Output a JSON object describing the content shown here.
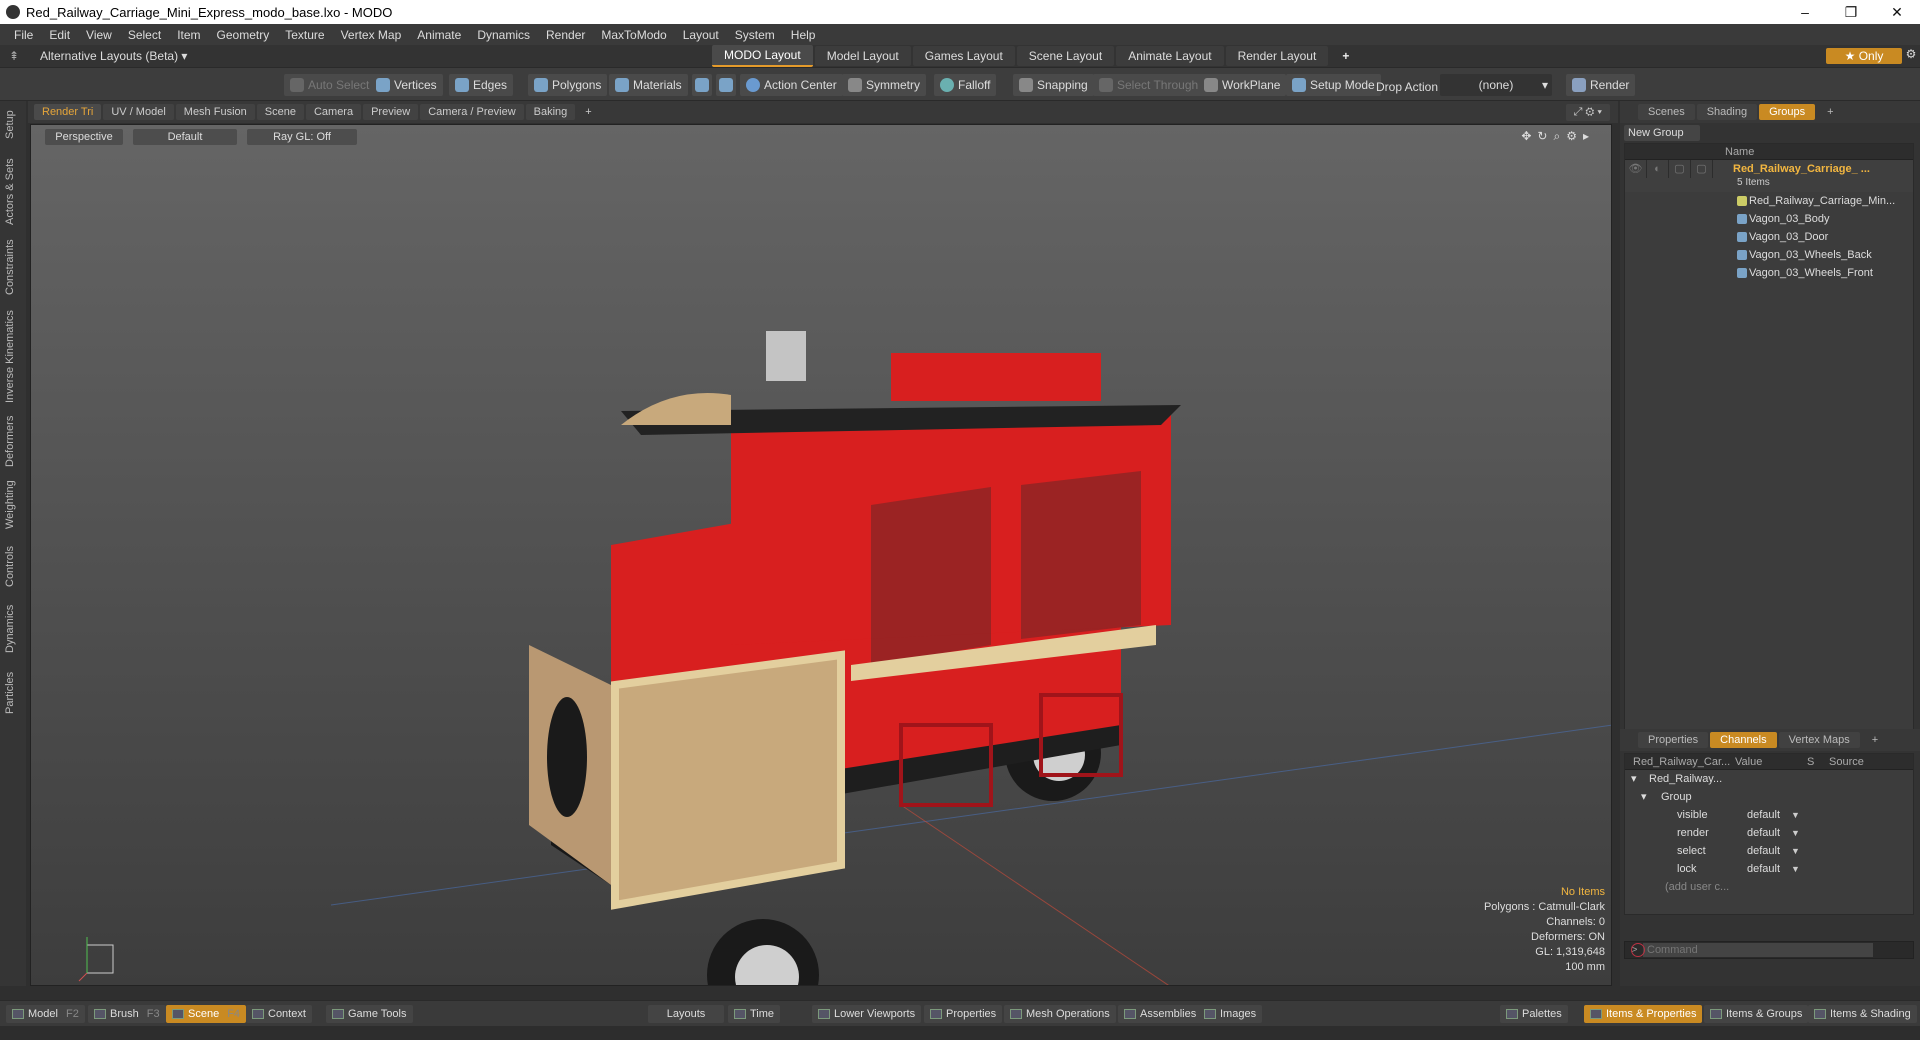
{
  "window": {
    "title": "Red_Railway_Carriage_Mini_Express_modo_base.lxo - MODO",
    "min": "–",
    "max": "❐",
    "close": "✕"
  },
  "menu": [
    "File",
    "Edit",
    "View",
    "Select",
    "Item",
    "Geometry",
    "Texture",
    "Vertex Map",
    "Animate",
    "Dynamics",
    "Render",
    "MaxToModo",
    "Layout",
    "System",
    "Help"
  ],
  "layoutbar": {
    "alt_layouts": "Alternative Layouts (Beta) ▾",
    "tabs": [
      "MODO Layout",
      "Model Layout",
      "Games Layout",
      "Scene Layout",
      "Animate Layout",
      "Render Layout"
    ],
    "active_tab": "MODO Layout",
    "plus": "+",
    "only": "★  Only"
  },
  "toolbar": {
    "auto_select": "Auto Select",
    "vertices": "Vertices",
    "edges": "Edges",
    "polygons": "Polygons",
    "materials": "Materials",
    "action_center": "Action Center",
    "symmetry": "Symmetry",
    "falloff": "Falloff",
    "snapping": "Snapping",
    "select_through": "Select Through",
    "workplane": "WorkPlane",
    "setup_mode": "Setup Mode",
    "drop_action": "Drop Action",
    "drop_value": "(none)",
    "render": "Render"
  },
  "left_tabs": [
    "Setup",
    "Actors & Sets",
    "Constraints",
    "Inverse Kinematics",
    "Deformers",
    "Weighting",
    "Controls",
    "Dynamics",
    "Particles"
  ],
  "viewport_tabs": [
    "Render Tri",
    "UV / Model",
    "Mesh Fusion",
    "Scene",
    "Camera",
    "Preview",
    "Camera / Preview",
    "Baking",
    "+"
  ],
  "viewport": {
    "perspective": "Perspective",
    "default": "Default",
    "raygl": "Ray GL: Off",
    "stats": {
      "items": "No Items",
      "polygons": "Polygons : Catmull-Clark",
      "channels": "Channels: 0",
      "deformers": "Deformers: ON",
      "gl": "GL: 1,319,648",
      "unit": "100 mm"
    }
  },
  "right_tabs_top": [
    "Scenes",
    "Shading",
    "Groups",
    "+"
  ],
  "groups": {
    "new_group": "New Group",
    "name_header": "Name",
    "group_name": "Red_Railway_Carriage_ ...",
    "group_count": "5 Items",
    "children": [
      "Red_Railway_Carriage_Min...",
      "Vagon_03_Body",
      "Vagon_03_Door",
      "Vagon_03_Wheels_Back",
      "Vagon_03_Wheels_Front"
    ]
  },
  "right_tabs_bottom": [
    "Properties",
    "Channels",
    "Vertex Maps",
    "+"
  ],
  "channels": {
    "headers": [
      "Red_Railway_Car...",
      "Value",
      "S",
      "Source"
    ],
    "item": "Red_Railway...",
    "group": "Group",
    "rows": [
      {
        "name": "visible",
        "value": "default"
      },
      {
        "name": "render",
        "value": "default"
      },
      {
        "name": "select",
        "value": "default"
      },
      {
        "name": "lock",
        "value": "default"
      }
    ],
    "add_user": "(add user c..."
  },
  "command": {
    "prompt": ">",
    "placeholder": "Command"
  },
  "bottombar": {
    "model": "Model",
    "model_key": "F2",
    "brush": "Brush",
    "brush_key": "F3",
    "scene": "Scene",
    "scene_key": "F4",
    "context": "Context",
    "game_tools": "Game Tools",
    "layouts": "Layouts",
    "time": "Time",
    "lower_viewports": "Lower Viewports",
    "properties": "Properties",
    "mesh_operations": "Mesh Operations",
    "assemblies": "Assemblies",
    "images": "Images",
    "palettes": "Palettes",
    "items_properties": "Items & Properties",
    "items_groups": "Items & Groups",
    "items_shading": "Items & Shading"
  },
  "colors": {
    "accent": "#c98a22",
    "carriage_red": "#d81f1f",
    "wood": "#c8a97c"
  }
}
